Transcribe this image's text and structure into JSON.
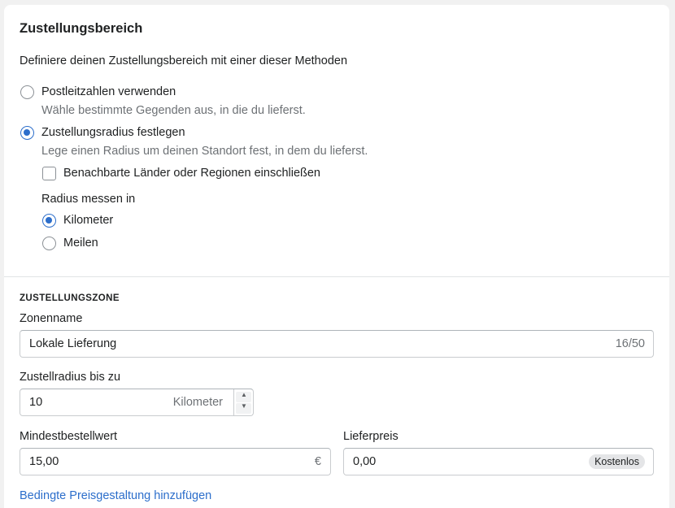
{
  "card": {
    "title": "Zustellungsbereich",
    "intro": "Definiere deinen Zustellungsbereich mit einer dieser Methoden"
  },
  "methods": [
    {
      "label": "Postleitzahlen verwenden",
      "help": "Wähle bestimmte Gegenden aus, in die du lieferst.",
      "checked": false
    },
    {
      "label": "Zustellungsradius festlegen",
      "help": "Lege einen Radius um deinen Standort fest, in dem du lieferst.",
      "checked": true
    }
  ],
  "neighbor_checkbox": {
    "label": "Benachbarte Länder oder Regionen einschließen",
    "checked": false
  },
  "radius_unit": {
    "label": "Radius messen in",
    "options": [
      {
        "label": "Kilometer",
        "checked": true
      },
      {
        "label": "Meilen",
        "checked": false
      }
    ]
  },
  "zone": {
    "heading": "ZUSTELLUNGSZONE",
    "name_label": "Zonenname",
    "name_value": "Lokale Lieferung",
    "name_count": "16/50",
    "radius_label": "Zustellradius bis zu",
    "radius_value": "10",
    "radius_suffix": "Kilometer",
    "min_order_label": "Mindestbestellwert",
    "min_order_value": "15,00",
    "min_order_suffix": "€",
    "price_label": "Lieferpreis",
    "price_value": "0,00",
    "price_badge": "Kostenlos",
    "add_link": "Bedingte Preisgestaltung hinzufügen"
  },
  "colors": {
    "accent": "#2c6ecb",
    "text": "#202223",
    "subdued": "#6d7175",
    "border": "#c9cccf"
  }
}
